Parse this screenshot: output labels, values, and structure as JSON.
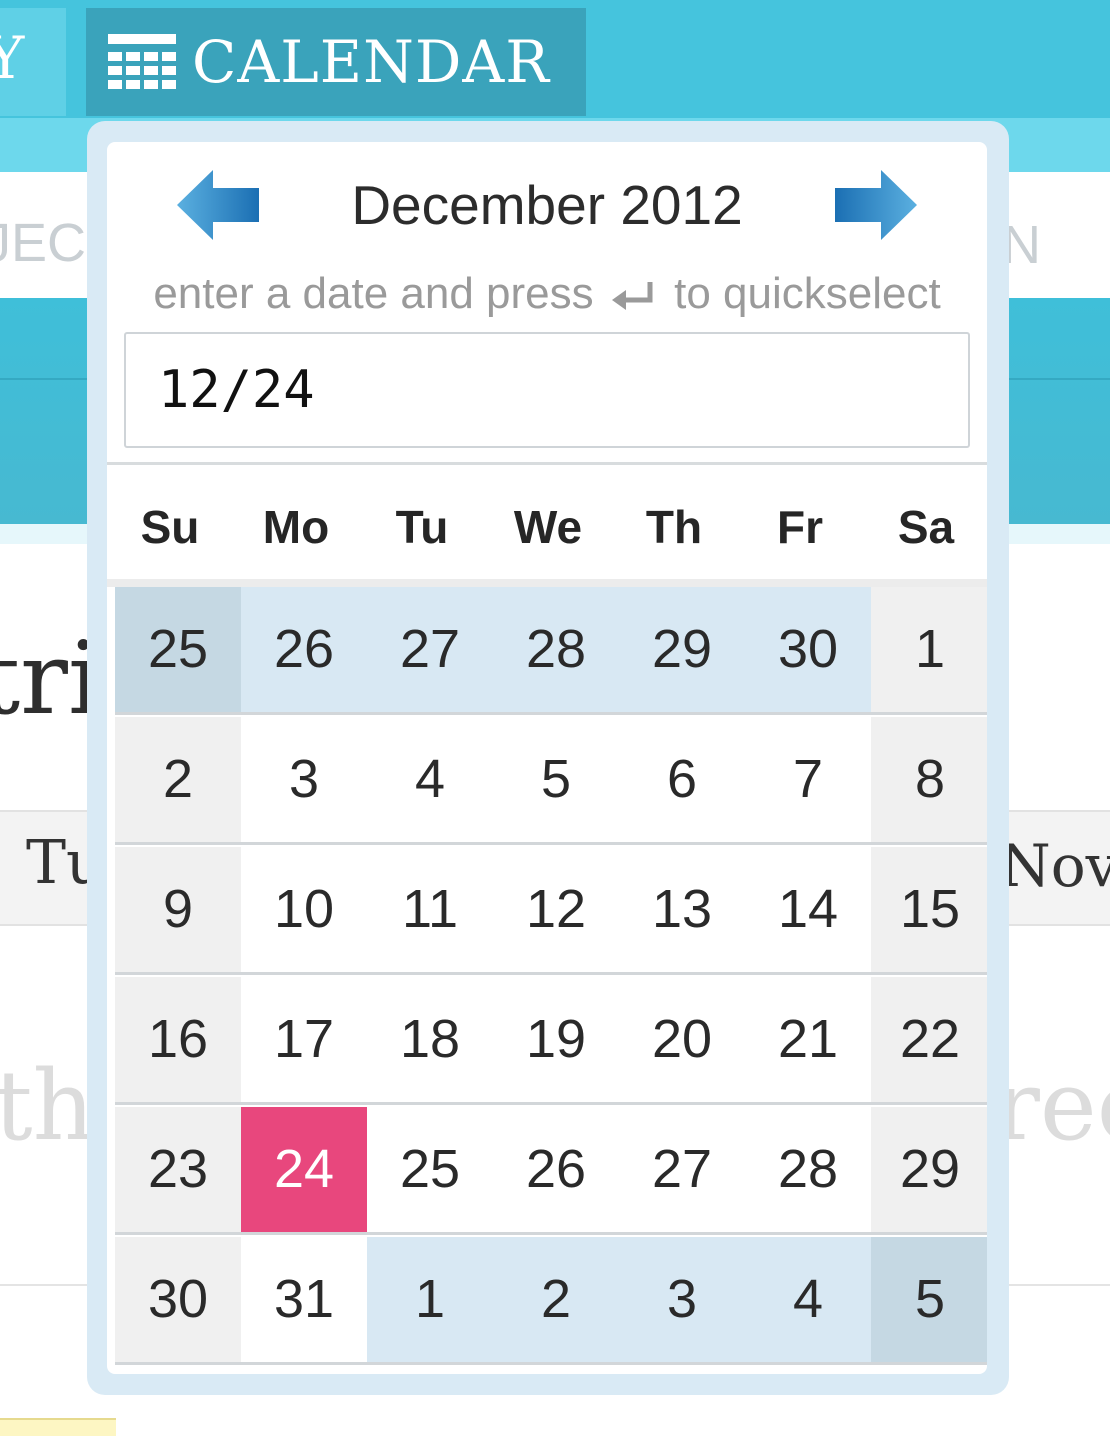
{
  "nav": {
    "prev_tab_text": "Y",
    "calendar_tab_label": "CALENDAR"
  },
  "background": {
    "sub_left_text": "JECT",
    "sub_right_text": "N",
    "word_tri": "tric",
    "word_tu": "Tu",
    "word_nov": "Nov",
    "word_thi": "thi",
    "word_ree": "ree"
  },
  "picker": {
    "month_title": "December 2012",
    "hint_before": "enter a date and press",
    "hint_after": "to quickselect",
    "input_value": "12/24",
    "arrow_color_light": "#5bb0e0",
    "arrow_color_dark": "#1b6fb3",
    "weekdays": [
      "Su",
      "Mo",
      "Tu",
      "We",
      "Th",
      "Fr",
      "Sa"
    ],
    "selected_day": "24",
    "selected_color": "#e8477d",
    "weeks": [
      [
        {
          "d": "25",
          "o": true
        },
        {
          "d": "26",
          "o": true
        },
        {
          "d": "27",
          "o": true
        },
        {
          "d": "28",
          "o": true
        },
        {
          "d": "29",
          "o": true
        },
        {
          "d": "30",
          "o": true
        },
        {
          "d": "1",
          "o": false
        }
      ],
      [
        {
          "d": "2",
          "o": false
        },
        {
          "d": "3",
          "o": false
        },
        {
          "d": "4",
          "o": false
        },
        {
          "d": "5",
          "o": false
        },
        {
          "d": "6",
          "o": false
        },
        {
          "d": "7",
          "o": false
        },
        {
          "d": "8",
          "o": false
        }
      ],
      [
        {
          "d": "9",
          "o": false
        },
        {
          "d": "10",
          "o": false
        },
        {
          "d": "11",
          "o": false
        },
        {
          "d": "12",
          "o": false
        },
        {
          "d": "13",
          "o": false
        },
        {
          "d": "14",
          "o": false
        },
        {
          "d": "15",
          "o": false
        }
      ],
      [
        {
          "d": "16",
          "o": false
        },
        {
          "d": "17",
          "o": false
        },
        {
          "d": "18",
          "o": false
        },
        {
          "d": "19",
          "o": false
        },
        {
          "d": "20",
          "o": false
        },
        {
          "d": "21",
          "o": false
        },
        {
          "d": "22",
          "o": false
        }
      ],
      [
        {
          "d": "23",
          "o": false
        },
        {
          "d": "24",
          "o": false,
          "s": true
        },
        {
          "d": "25",
          "o": false
        },
        {
          "d": "26",
          "o": false
        },
        {
          "d": "27",
          "o": false
        },
        {
          "d": "28",
          "o": false
        },
        {
          "d": "29",
          "o": false
        }
      ],
      [
        {
          "d": "30",
          "o": false
        },
        {
          "d": "31",
          "o": false
        },
        {
          "d": "1",
          "o": true
        },
        {
          "d": "2",
          "o": true
        },
        {
          "d": "3",
          "o": true
        },
        {
          "d": "4",
          "o": true
        },
        {
          "d": "5",
          "o": true
        }
      ]
    ]
  }
}
